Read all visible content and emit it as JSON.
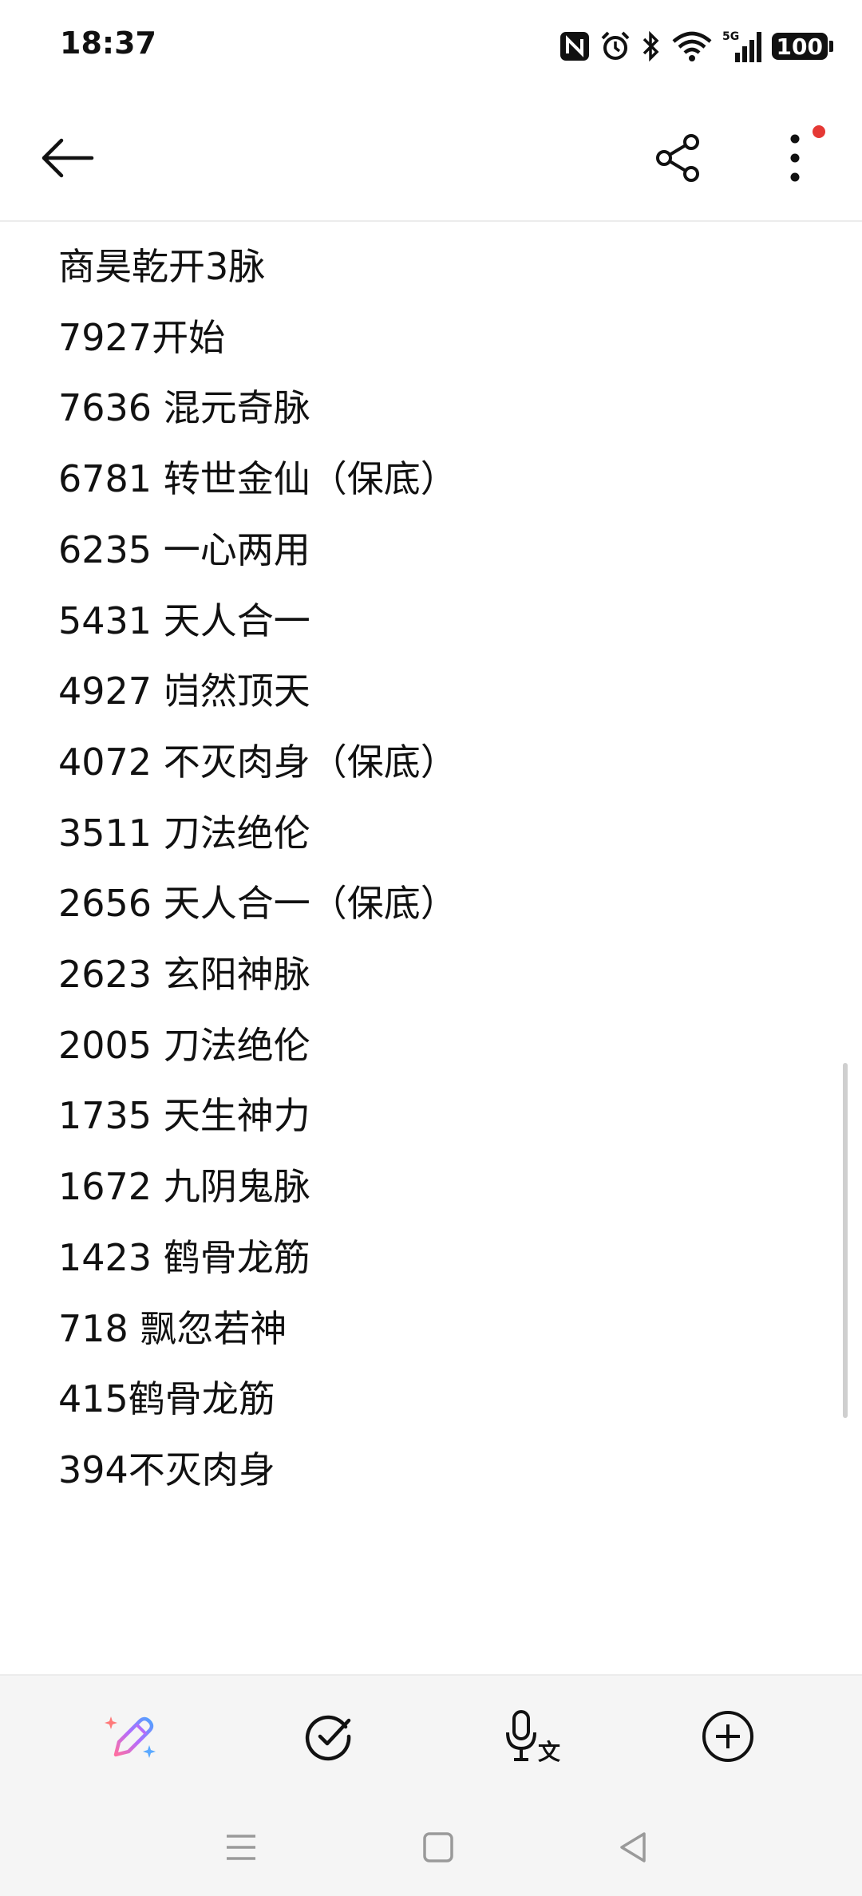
{
  "status_bar": {
    "time": "18:37",
    "network": "5G",
    "battery": "100",
    "icons": [
      "nfc-icon",
      "alarm-icon",
      "bluetooth-icon",
      "wifi-icon",
      "signal-icon",
      "battery-icon"
    ]
  },
  "toolbar": {
    "icons": [
      "back-arrow-icon",
      "share-icon",
      "more-vert-icon"
    ],
    "notification_dot_color": "#e53935"
  },
  "note": {
    "lines": [
      "商昊乾开3脉",
      "7927开始",
      "7636 混元奇脉",
      "6781 转世金仙（保底）",
      "6235 一心两用",
      "5431 天人合一",
      "4927 岿然顶天",
      "4072 不灭肉身（保底）",
      "3511 刀法绝伦",
      "2656 天人合一（保底）",
      "2623 玄阳神脉",
      "2005 刀法绝伦",
      "1735 天生神力",
      "1672 九阴鬼脉",
      "1423 鹤骨龙筋",
      "718 飘忽若神",
      "415鹤骨龙筋",
      "394不灭肉身"
    ]
  },
  "bottom_toolbar": {
    "icons": [
      "ai-pen-icon",
      "checklist-icon",
      "voice-to-text-icon",
      "add-icon"
    ]
  },
  "nav_bar": {
    "icons": [
      "recents-icon",
      "home-icon",
      "back-icon"
    ]
  }
}
